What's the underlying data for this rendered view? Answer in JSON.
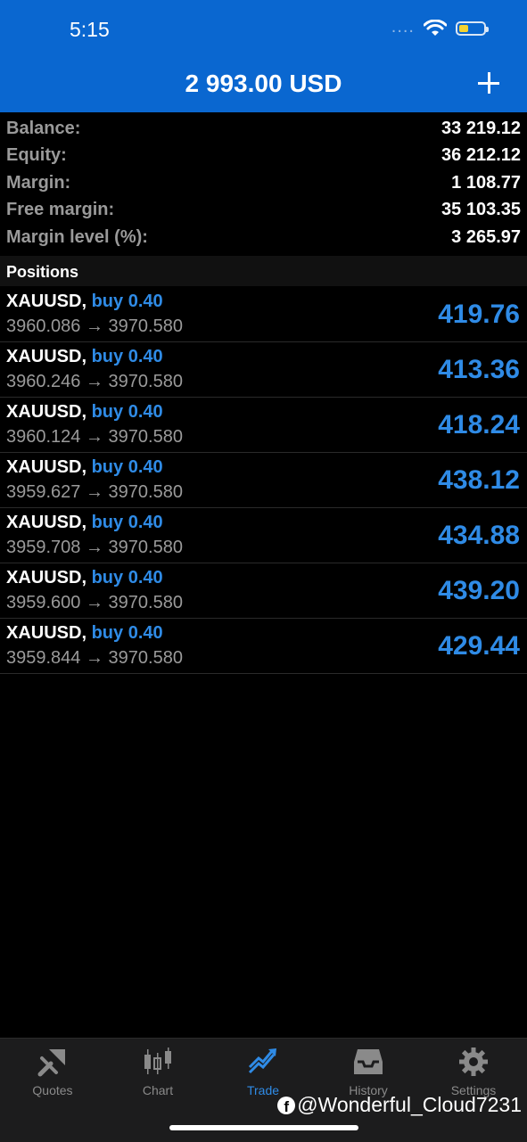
{
  "status": {
    "time": "5:15",
    "signal": "....",
    "battery_color": "#f5d330"
  },
  "header": {
    "title": "2 993.00 USD",
    "add_icon": "plus-icon",
    "background": "#0a67d0"
  },
  "summary": [
    {
      "label": "Balance:",
      "value": "33 219.12"
    },
    {
      "label": "Equity:",
      "value": "36 212.12"
    },
    {
      "label": "Margin:",
      "value": "1 108.77"
    },
    {
      "label": "Free margin:",
      "value": "35 103.35"
    },
    {
      "label": "Margin level (%):",
      "value": "3 265.97"
    }
  ],
  "positions_title": "Positions",
  "positions": [
    {
      "symbol": "XAUUSD,",
      "side": "buy 0.40",
      "prices": "3960.086 → 3970.580",
      "profit": "419.76"
    },
    {
      "symbol": "XAUUSD,",
      "side": "buy 0.40",
      "prices": "3960.246 → 3970.580",
      "profit": "413.36"
    },
    {
      "symbol": "XAUUSD,",
      "side": "buy 0.40",
      "prices": "3960.124 → 3970.580",
      "profit": "418.24"
    },
    {
      "symbol": "XAUUSD,",
      "side": "buy 0.40",
      "prices": "3959.627 → 3970.580",
      "profit": "438.12"
    },
    {
      "symbol": "XAUUSD,",
      "side": "buy 0.40",
      "prices": "3959.708 → 3970.580",
      "profit": "434.88"
    },
    {
      "symbol": "XAUUSD,",
      "side": "buy 0.40",
      "prices": "3959.600 → 3970.580",
      "profit": "439.20"
    },
    {
      "symbol": "XAUUSD,",
      "side": "buy 0.40",
      "prices": "3959.844 → 3970.580",
      "profit": "429.44"
    }
  ],
  "tabs": [
    {
      "label": "Quotes",
      "icon": "quotes-icon"
    },
    {
      "label": "Chart",
      "icon": "candlestick-icon"
    },
    {
      "label": "Trade",
      "icon": "trade-icon",
      "active": true
    },
    {
      "label": "History",
      "icon": "inbox-icon"
    },
    {
      "label": "Settings",
      "icon": "gear-icon"
    }
  ],
  "watermark": "@Wonderful_Cloud7231",
  "colors": {
    "accent": "#2f8be6",
    "muted": "#9a9a9a"
  }
}
